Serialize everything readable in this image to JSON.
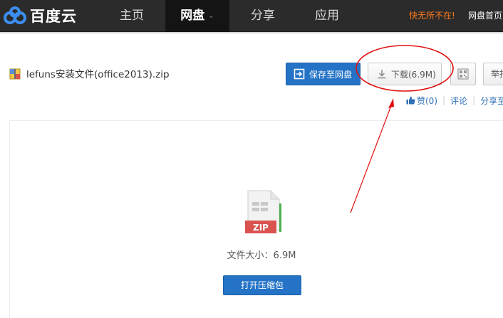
{
  "header": {
    "logo_text": "百度云",
    "nav": [
      {
        "label": "主页"
      },
      {
        "label": "网盘",
        "caret": "⌄"
      },
      {
        "label": "分享"
      },
      {
        "label": "应用"
      }
    ],
    "slogan": "快无所不在!",
    "home_link": "网盘首页"
  },
  "file": {
    "name": "lefuns安装文件(office2013).zip",
    "save_button": "保存至网盘",
    "download_button": "下载(6.9M)",
    "report_button": "举报",
    "actions": {
      "like": "赞(0)",
      "comment": "评论",
      "share": "分享至"
    }
  },
  "preview": {
    "type_badge": "ZIP",
    "size_text": "文件大小：6.9M",
    "open_button": "打开压缩包"
  },
  "colors": {
    "topbar": "#2b2b2b",
    "accent_blue": "#2473c6",
    "slogan_orange": "#ff7a1a",
    "annotation_red": "#e01010"
  }
}
